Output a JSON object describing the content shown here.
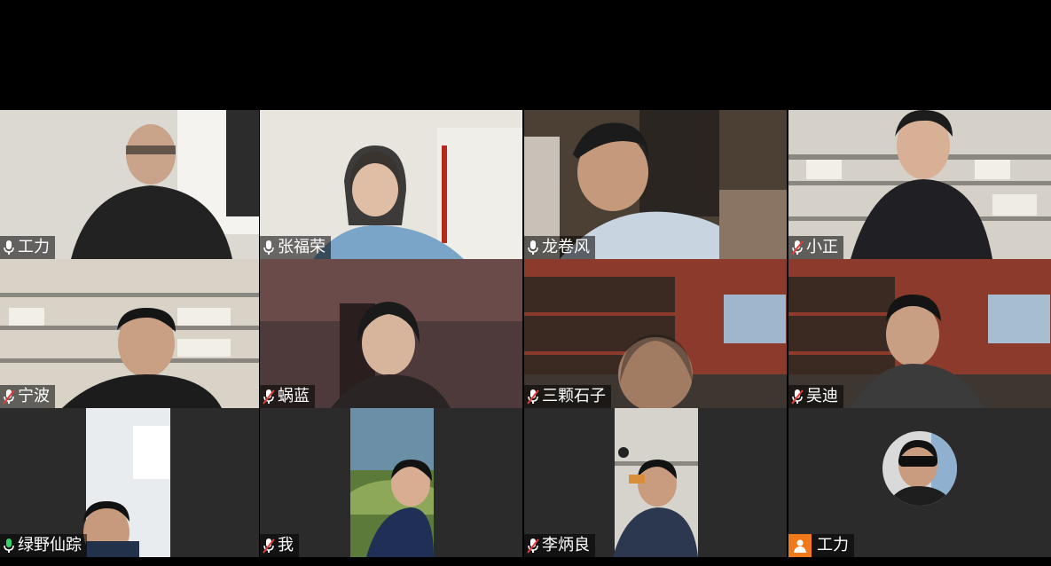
{
  "participants": [
    {
      "name": "工力",
      "mic": "on",
      "colors": [
        "#dcd8d2",
        "#2a2a2a",
        "#e9e6e0"
      ]
    },
    {
      "name": "张福荣",
      "mic": "on",
      "colors": [
        "#e8e5df",
        "#7aa5c8",
        "#f0eee9"
      ]
    },
    {
      "name": "龙卷风",
      "mic": "on",
      "colors": [
        "#4c3f33",
        "#c8d4e0",
        "#8a7564"
      ]
    },
    {
      "name": "小正",
      "mic": "muted",
      "colors": [
        "#d6d1c8",
        "#1f1f24",
        "#b8ad9e"
      ]
    },
    {
      "name": "宁波",
      "mic": "muted",
      "colors": [
        "#d8d2c7",
        "#1c1c1c",
        "#bfb4a4"
      ]
    },
    {
      "name": "蜗蓝",
      "mic": "muted",
      "colors": [
        "#4e3a3a",
        "#6b4a4a",
        "#d7c7c2"
      ]
    },
    {
      "name": "三颗石子",
      "mic": "muted",
      "colors": [
        "#8b3a2b",
        "#3a2a22",
        "#9fb6cc"
      ]
    },
    {
      "name": "吴迪",
      "mic": "muted",
      "colors": [
        "#8b3a2b",
        "#3b3b3b",
        "#a7bdd0"
      ]
    },
    {
      "name": "绿野仙踪",
      "mic": "active",
      "colors": [
        "#2b2b2b",
        "#e8ecef",
        "#22324a"
      ]
    },
    {
      "name": "我",
      "mic": "muted",
      "colors": [
        "#2b2b2b",
        "#6a8fa6",
        "#5c7a3a"
      ]
    },
    {
      "name": "李炳良",
      "mic": "muted",
      "colors": [
        "#2b2b2b",
        "#d6d3cd",
        "#2c3850"
      ]
    },
    {
      "name": "工力",
      "mic": "none",
      "colors": [
        "#2b2b2b",
        "#1e1e1e",
        "#d9d9d9"
      ]
    }
  ]
}
